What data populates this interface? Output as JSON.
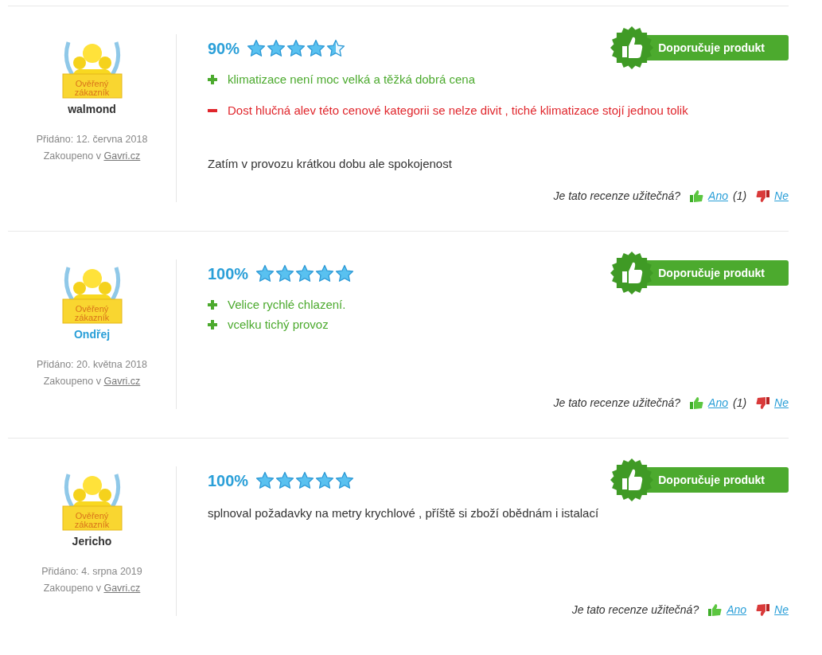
{
  "reviews": [
    {
      "badge": "Ověřený zákazník",
      "author": "walmond",
      "author_linked": false,
      "added": "Přidáno: 12. června 2018",
      "bought_prefix": "Zakoupeno v ",
      "shop": "Gavri.cz",
      "percent": "90%",
      "stars": 4.5,
      "verdict": "Doporučuje produkt",
      "points": [
        {
          "kind": "pro",
          "text": "klimatizace není moc velká a těžká dobrá cena"
        },
        {
          "kind": "con",
          "text": "Dost hlučná alev této cenové kategorii se nelze divit , tiché klimatizace stojí jednou tolik"
        }
      ],
      "text": "Zatím v provozu krátkou dobu ale spokojenost",
      "helpful": {
        "question": "Je tato recenze užitečná?",
        "yes": "Ano ",
        "yes_count": "(1)",
        "no": "Ne"
      }
    },
    {
      "badge": "Ověřený zákazník",
      "author": "Ondřej",
      "author_linked": true,
      "added": "Přidáno: 20. května 2018",
      "bought_prefix": "Zakoupeno v ",
      "shop": "Gavri.cz",
      "percent": "100%",
      "stars": 5,
      "verdict": "Doporučuje produkt",
      "points": [
        {
          "kind": "pro",
          "text": "Velice rychlé chlazení."
        },
        {
          "kind": "pro",
          "text": "vcelku tichý provoz"
        }
      ],
      "helpful": {
        "question": "Je tato recenze užitečná?",
        "yes": "Ano ",
        "yes_count": "(1)",
        "no": "Ne"
      }
    },
    {
      "badge": "Ověřený zákazník",
      "author": "Jericho",
      "author_linked": false,
      "added": "Přidáno: 4. srpna 2019",
      "bought_prefix": "Zakoupeno v ",
      "shop": "Gavri.cz",
      "percent": "100%",
      "stars": 5,
      "verdict": "Doporučuje produkt",
      "text": "splnoval požadavky na metry krychlové , příště si zboží obědnám i istalací",
      "helpful": {
        "question": "Je tato recenze užitečná?",
        "yes": "Ano",
        "no": "Ne"
      }
    }
  ]
}
